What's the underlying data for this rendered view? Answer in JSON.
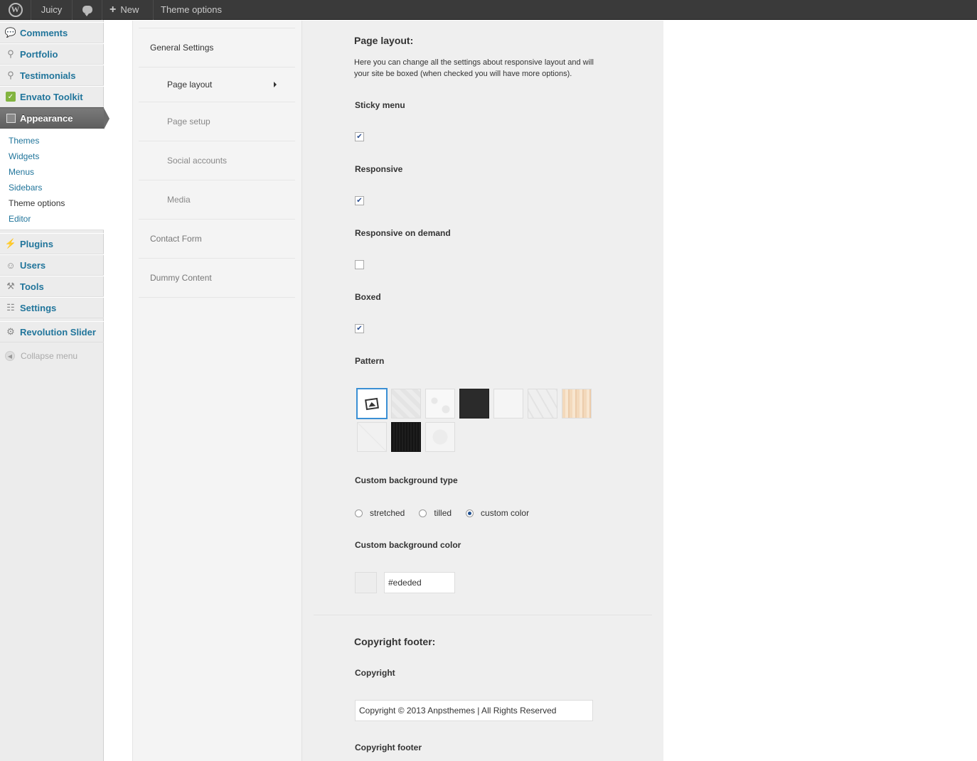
{
  "adminbar": {
    "wp_logo": "W",
    "site_name": "Juicy",
    "new_label": "New",
    "page_label": "Theme options"
  },
  "sidebar": {
    "items_top": [
      {
        "label": "Comments",
        "icon": "comment-icon"
      },
      {
        "label": "Portfolio",
        "icon": "pin-icon"
      },
      {
        "label": "Testimonials",
        "icon": "pin-icon"
      },
      {
        "label": "Envato Toolkit",
        "icon": "envato-icon"
      },
      {
        "label": "Appearance",
        "icon": "appearance-icon"
      }
    ],
    "appearance_sub": [
      "Themes",
      "Widgets",
      "Menus",
      "Sidebars",
      "Theme options",
      "Editor"
    ],
    "items_bottom": [
      {
        "label": "Plugins",
        "icon": "plugin-icon"
      },
      {
        "label": "Users",
        "icon": "users-icon"
      },
      {
        "label": "Tools",
        "icon": "tools-icon"
      },
      {
        "label": "Settings",
        "icon": "settings-icon"
      }
    ],
    "revslider": "Revolution Slider",
    "collapse": "Collapse menu"
  },
  "options_nav": {
    "general": "General Settings",
    "page_layout": "Page layout",
    "page_setup": "Page setup",
    "social": "Social accounts",
    "media": "Media",
    "contact": "Contact Form",
    "dummy": "Dummy Content"
  },
  "page_layout": {
    "title": "Page layout:",
    "description": "Here you can change all the settings about responsive layout and will your site be boxed (when checked you will have more options).",
    "sticky_menu": {
      "label": "Sticky menu",
      "checked": true
    },
    "responsive": {
      "label": "Responsive",
      "checked": true
    },
    "responsive_on_demand": {
      "label": "Responsive on demand",
      "checked": false
    },
    "boxed": {
      "label": "Boxed",
      "checked": true
    },
    "pattern_label": "Pattern",
    "custom_bg_type_label": "Custom background type",
    "bg_types": [
      "stretched",
      "tilled",
      "custom color"
    ],
    "bg_type_selected": "custom color",
    "custom_bg_color_label": "Custom background color",
    "custom_bg_color": "#ededed"
  },
  "copyright": {
    "title": "Copyright footer:",
    "copyright_label": "Copyright",
    "copyright_value": "Copyright © 2013 Anpsthemes | All Rights Reserved",
    "footer_label": "Copyright footer"
  },
  "colors": {
    "link": "#21759b",
    "adminbar": "#3a3a3a",
    "selected_pattern": "#3a8fd4"
  }
}
